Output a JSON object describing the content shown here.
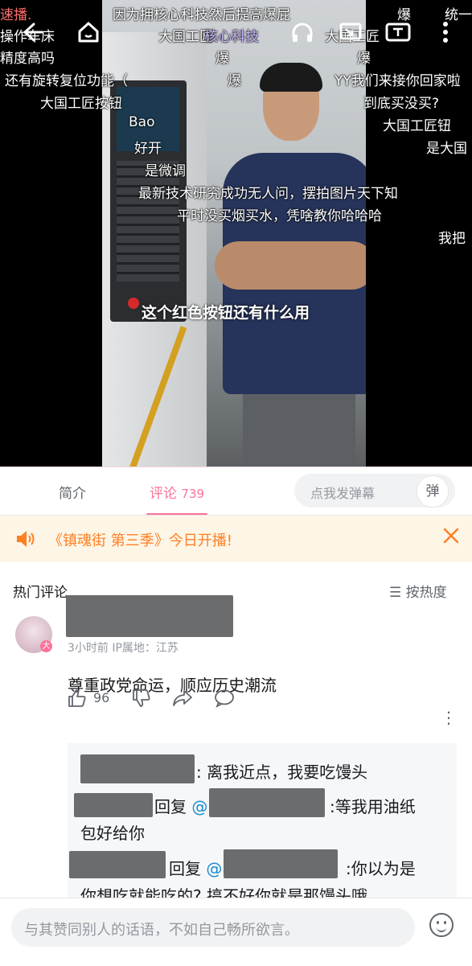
{
  "video": {
    "danmaku": [
      {
        "text": "因为拥核心科技然后提高爆屁"
      },
      {
        "text": "爆"
      },
      {
        "text": "统一"
      },
      {
        "text": "操作车床"
      },
      {
        "text": "大国工匠"
      },
      {
        "text": "核心科技"
      },
      {
        "text": "大国工匠"
      },
      {
        "text": "精度高吗"
      },
      {
        "text": "爆"
      },
      {
        "text": "爆"
      },
      {
        "text": "还有旋转复位功能（"
      },
      {
        "text": "爆"
      },
      {
        "text": "YY我们来接你回家啦"
      },
      {
        "text": "大国工匠按钮"
      },
      {
        "text": "到底买没买?"
      },
      {
        "text": "Bao"
      },
      {
        "text": "大国工匠钮"
      },
      {
        "text": "好开"
      },
      {
        "text": "是大国"
      },
      {
        "text": "是微调"
      },
      {
        "text": "最新技术研究成功无人问，摆拍图片天下知"
      },
      {
        "text": "平时没买烟买水，凭啥教你哈哈哈"
      },
      {
        "text": "我把"
      },
      {
        "text": "速播."
      }
    ],
    "caption": "这个红色按钮还有什么用",
    "icons": [
      "back-arrow-icon",
      "home-icon",
      "headphones-icon",
      "cast-icon",
      "tv-icon",
      "more-vertical-icon"
    ]
  },
  "tabs": {
    "intro": "简介",
    "comments": "评论",
    "comments_count": "739",
    "danmu_placeholder": "点我发弹幕",
    "danmu_button": "弹"
  },
  "notice": {
    "text": "《镇魂街 第三季》今日开播!",
    "accent": "#ff7f24"
  },
  "comments": {
    "section_title": "热门评论",
    "sort_label": "按热度",
    "top": {
      "meta": "3小时前  IP属地：江苏",
      "text": "尊重政党命运，顺应历史潮流",
      "likes": "96",
      "badge": "大"
    },
    "replies": [
      {
        "text": ": 离我近点，我要吃馒头"
      },
      {
        "prefix": "回复",
        "at": "@",
        "text": ":等我用油纸",
        "text2": "包好给你"
      },
      {
        "prefix": "回复",
        "at": "@",
        "text": ":你以为是",
        "text2": "你想吃就能吃的? 搞不好你就是那馒头哦。"
      }
    ]
  },
  "bottom": {
    "placeholder": "与其赞同别人的话语，不如自己畅所欲言。"
  },
  "colors": {
    "brand": "#fb7299",
    "link": "#178bcf"
  }
}
